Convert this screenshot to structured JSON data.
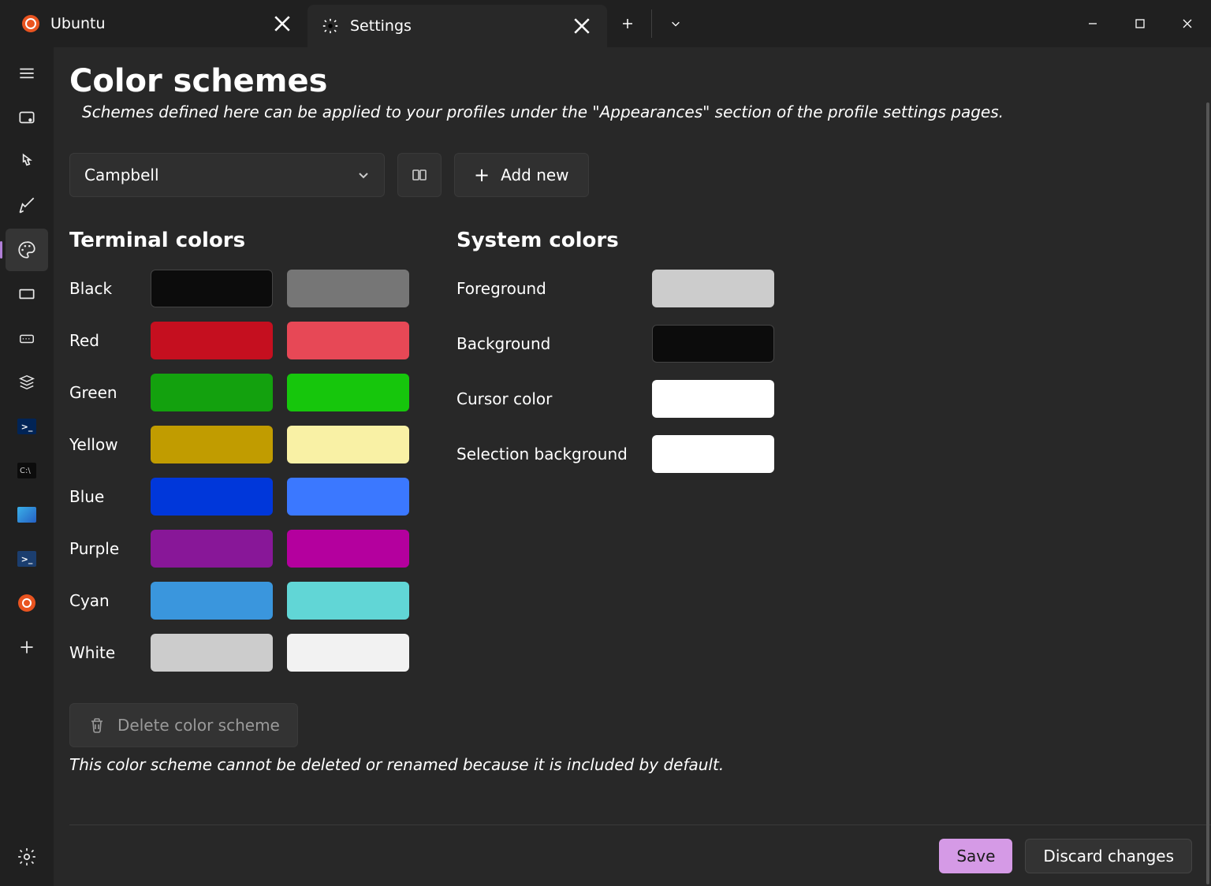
{
  "tabs": {
    "ubuntu": "Ubuntu",
    "settings": "Settings"
  },
  "page": {
    "title": "Color schemes",
    "description": "Schemes defined here can be applied to your profiles under the \"Appearances\" section of the profile settings pages."
  },
  "controls": {
    "scheme_selected": "Campbell",
    "add_new": "Add new",
    "delete_scheme": "Delete color scheme",
    "delete_note": "This color scheme cannot be deleted or renamed because it is included by default."
  },
  "sections": {
    "terminal_colors": "Terminal colors",
    "system_colors": "System colors"
  },
  "terminal_colors": [
    {
      "name": "Black",
      "normal": "#0C0C0C",
      "bright": "#767676"
    },
    {
      "name": "Red",
      "normal": "#C50F1F",
      "bright": "#E74856"
    },
    {
      "name": "Green",
      "normal": "#13A10E",
      "bright": "#16C60C"
    },
    {
      "name": "Yellow",
      "normal": "#C19C00",
      "bright": "#F9F1A5"
    },
    {
      "name": "Blue",
      "normal": "#0037DA",
      "bright": "#3B78FF"
    },
    {
      "name": "Purple",
      "normal": "#881798",
      "bright": "#B4009E"
    },
    {
      "name": "Cyan",
      "normal": "#3A96DD",
      "bright": "#61D6D6"
    },
    {
      "name": "White",
      "normal": "#CCCCCC",
      "bright": "#F2F2F2"
    }
  ],
  "system_colors": [
    {
      "name": "Foreground",
      "value": "#CCCCCC"
    },
    {
      "name": "Background",
      "value": "#0C0C0C"
    },
    {
      "name": "Cursor color",
      "value": "#FFFFFF"
    },
    {
      "name": "Selection background",
      "value": "#FFFFFF"
    }
  ],
  "footer": {
    "save": "Save",
    "discard": "Discard changes"
  }
}
